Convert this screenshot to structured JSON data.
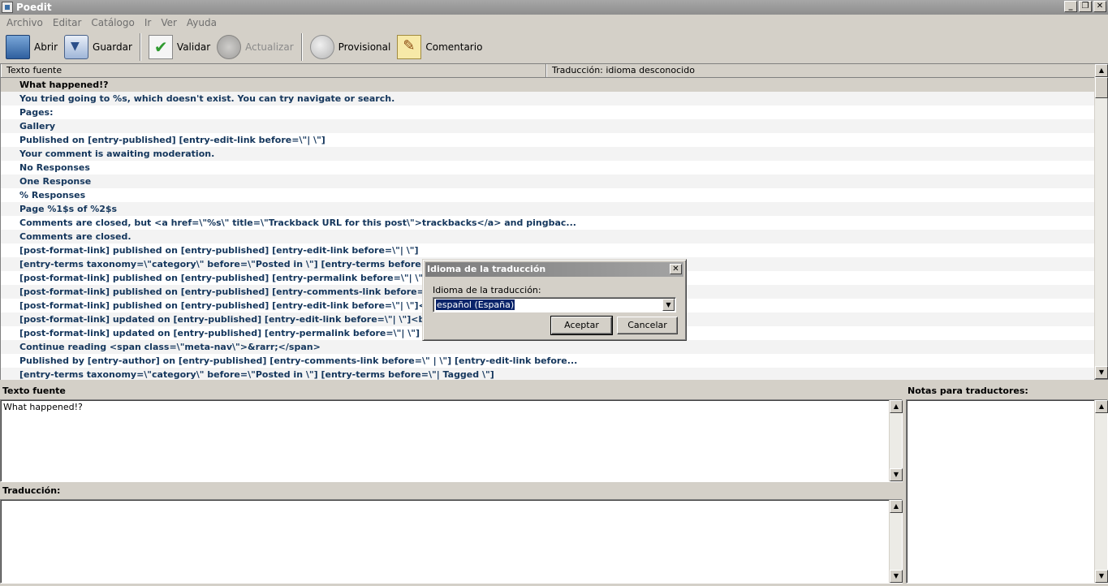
{
  "window": {
    "title": "Poedit"
  },
  "menu": [
    "Archivo",
    "Editar",
    "Catálogo",
    "Ir",
    "Ver",
    "Ayuda"
  ],
  "toolbar": {
    "open": "Abrir",
    "save": "Guardar",
    "validate": "Validar",
    "update": "Actualizar",
    "fuzzy": "Provisional",
    "comment": "Comentario"
  },
  "list": {
    "col_source": "Texto fuente",
    "col_translation": "Traducción: idioma desconocido",
    "rows": [
      "What happened!?",
      "You tried going to %s, which doesn't exist. You can try navigate or search.",
      "Pages:",
      "Gallery",
      "Published on [entry-published] [entry-edit-link before=\\\"| \\\"]",
      "Your comment is awaiting moderation.",
      "No Responses",
      "One Response",
      "% Responses",
      "Page %1$s of %2$s",
      "Comments are closed, but <a href=\\\"%s\\\" title=\\\"Trackback URL for this post\\\">trackbacks</a> and pingbac...",
      "Comments are closed.",
      "[post-format-link] published on [entry-published] [entry-edit-link before=\\\"| \\\"]",
      "[entry-terms taxonomy=\\\"category\\\" before=\\\"Posted in \\\"] [entry-terms before=\\\"",
      "[post-format-link] published on [entry-published] [entry-permalink before=\\\"| \\\"] [ent",
      "[post-format-link] published on [entry-published] [entry-comments-link before=\\\" | \\\"",
      "[post-format-link] published on [entry-published] [entry-edit-link before=\\\"| \\\"]<br />",
      "[post-format-link] updated on [entry-published] [entry-edit-link before=\\\"| \\\"]<br />[",
      "[post-format-link] updated on [entry-published] [entry-permalink before=\\\"| \\\"] [entr",
      "Continue reading <span class=\\\"meta-nav\\\">&rarr;</span>",
      "Published by [entry-author] on [entry-published] [entry-comments-link before=\\\" | \\\"] [entry-edit-link before...",
      "[entry-terms taxonomy=\\\"category\\\" before=\\\"Posted in \\\"] [entry-terms before=\\\"| Tagged \\\"]"
    ]
  },
  "panels": {
    "source_label": "Texto fuente",
    "source_text": "What happened!?",
    "translation_label": "Traducción:",
    "notes_label": "Notas para traductores:"
  },
  "dialog": {
    "title": "Idioma de la traducción",
    "field_label": "Idioma de la traducción:",
    "selected": "español (España)",
    "ok": "Aceptar",
    "cancel": "Cancelar"
  }
}
